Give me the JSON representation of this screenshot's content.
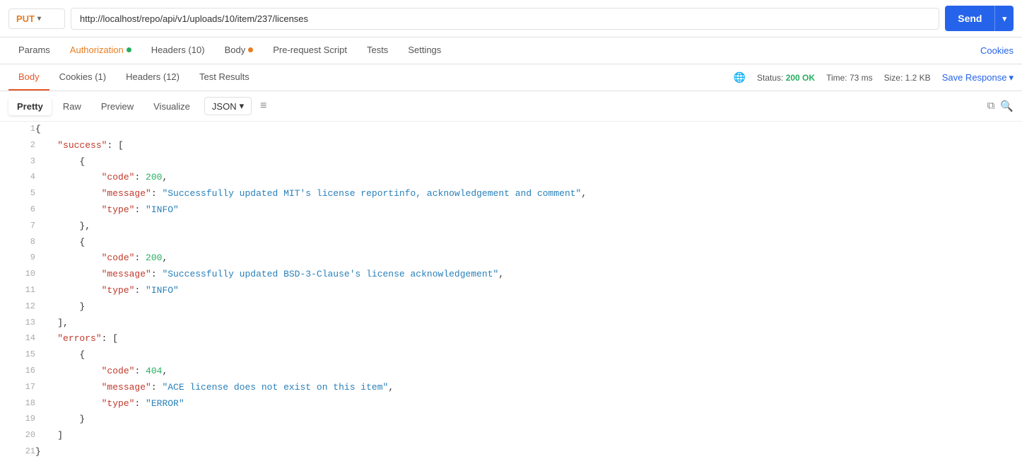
{
  "method": {
    "label": "PUT",
    "chevron": "▾"
  },
  "url": {
    "value": "http://localhost/repo/api/v1/uploads/10/item/237/licenses"
  },
  "send_button": {
    "label": "Send",
    "caret": "▾"
  },
  "request_tabs": [
    {
      "id": "params",
      "label": "Params",
      "dot": false,
      "active": false
    },
    {
      "id": "authorization",
      "label": "Authorization",
      "dot": true,
      "dot_color": "green",
      "active": true
    },
    {
      "id": "headers",
      "label": "Headers (10)",
      "dot": false,
      "active": false
    },
    {
      "id": "body",
      "label": "Body",
      "dot": true,
      "dot_color": "orange",
      "active": false
    },
    {
      "id": "pre-request",
      "label": "Pre-request Script",
      "dot": false,
      "active": false
    },
    {
      "id": "tests",
      "label": "Tests",
      "dot": false,
      "active": false
    },
    {
      "id": "settings",
      "label": "Settings",
      "dot": false,
      "active": false
    }
  ],
  "cookies_link": "Cookies",
  "response_tabs": [
    {
      "id": "body",
      "label": "Body",
      "active": true
    },
    {
      "id": "cookies",
      "label": "Cookies (1)",
      "active": false
    },
    {
      "id": "headers",
      "label": "Headers (12)",
      "active": false
    },
    {
      "id": "test-results",
      "label": "Test Results",
      "active": false
    }
  ],
  "status": {
    "globe": "🌐",
    "text": "Status:",
    "code": "200 OK",
    "time_label": "Time:",
    "time": "73 ms",
    "size_label": "Size:",
    "size": "1.2 KB"
  },
  "save_response": "Save Response",
  "format_bar": {
    "pretty": "Pretty",
    "raw": "Raw",
    "preview": "Preview",
    "visualize": "Visualize",
    "json": "JSON",
    "chevron": "▾"
  },
  "json_lines": [
    {
      "num": 1,
      "code": "{"
    },
    {
      "num": 2,
      "code": "    \"success\": ["
    },
    {
      "num": 3,
      "code": "        {"
    },
    {
      "num": 4,
      "code": "            \"code\": 200,"
    },
    {
      "num": 5,
      "code": "            \"message\": \"Successfully updated MIT's license reportinfo, acknowledgement and comment\","
    },
    {
      "num": 6,
      "code": "            \"type\": \"INFO\""
    },
    {
      "num": 7,
      "code": "        },"
    },
    {
      "num": 8,
      "code": "        {"
    },
    {
      "num": 9,
      "code": "            \"code\": 200,"
    },
    {
      "num": 10,
      "code": "            \"message\": \"Successfully updated BSD-3-Clause's license acknowledgement\","
    },
    {
      "num": 11,
      "code": "            \"type\": \"INFO\""
    },
    {
      "num": 12,
      "code": "        }"
    },
    {
      "num": 13,
      "code": "    ],"
    },
    {
      "num": 14,
      "code": "    \"errors\": ["
    },
    {
      "num": 15,
      "code": "        {"
    },
    {
      "num": 16,
      "code": "            \"code\": 404,"
    },
    {
      "num": 17,
      "code": "            \"message\": \"ACE license does not exist on this item\","
    },
    {
      "num": 18,
      "code": "            \"type\": \"ERROR\""
    },
    {
      "num": 19,
      "code": "        }"
    },
    {
      "num": 20,
      "code": "    ]"
    },
    {
      "num": 21,
      "code": "}"
    }
  ]
}
